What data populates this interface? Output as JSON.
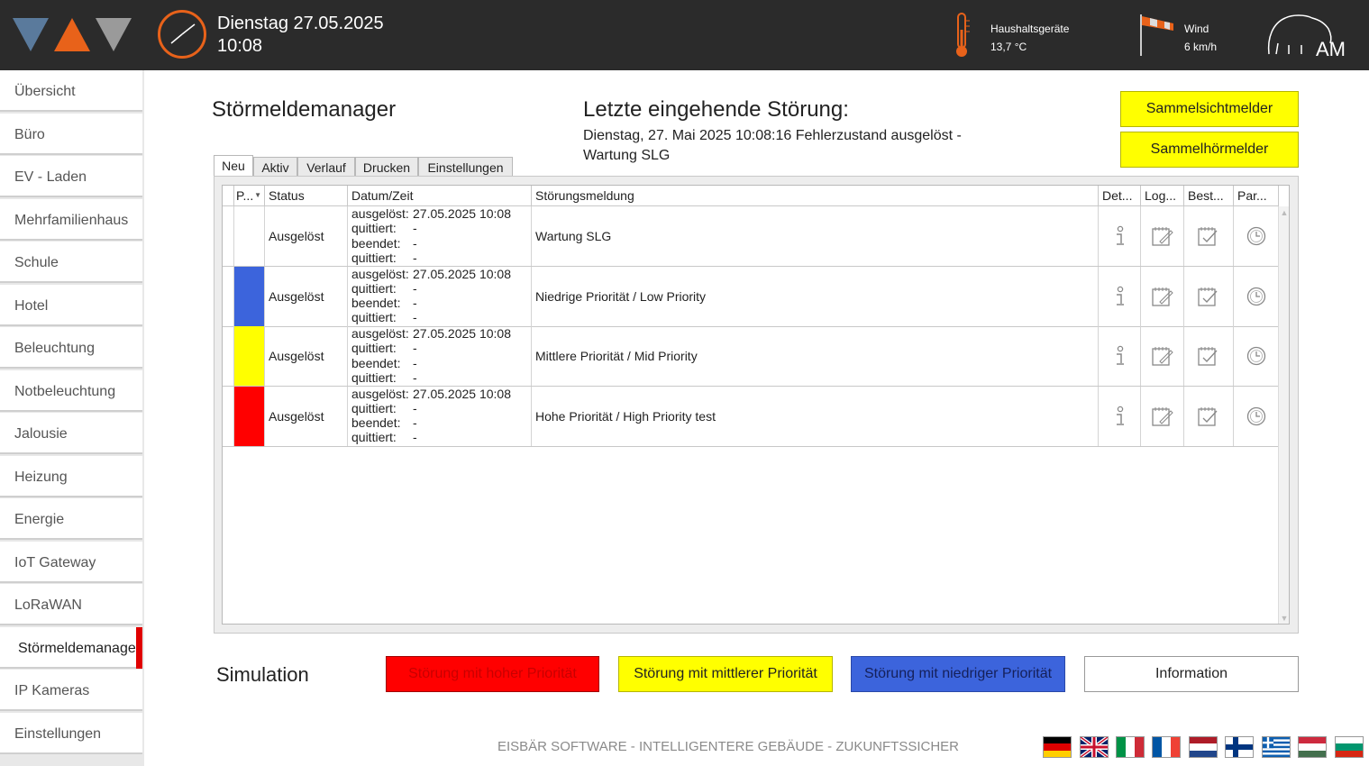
{
  "header": {
    "date": "Dienstag 27.05.2025",
    "time": "10:08",
    "temperature": {
      "label": "Haushaltsgeräte",
      "value": "13,7 °C"
    },
    "wind": {
      "label": "Wind",
      "value": "6 km/h"
    },
    "brand_text": "AM"
  },
  "sidebar": {
    "items": [
      {
        "label": "Übersicht"
      },
      {
        "label": "Büro"
      },
      {
        "label": "EV - Laden"
      },
      {
        "label": "Mehrfamilienhaus"
      },
      {
        "label": "Schule"
      },
      {
        "label": "Hotel"
      },
      {
        "label": "Beleuchtung"
      },
      {
        "label": "Notbeleuchtung"
      },
      {
        "label": "Jalousie"
      },
      {
        "label": "Heizung"
      },
      {
        "label": "Energie"
      },
      {
        "label": "IoT Gateway"
      },
      {
        "label": "LoRaWAN"
      },
      {
        "label": "Störmeldemanager",
        "active": true
      },
      {
        "label": "IP Kameras"
      },
      {
        "label": "Einstellungen"
      }
    ]
  },
  "main": {
    "title": "Störmeldemanager",
    "last_fault_title": "Letzte eingehende Störung:",
    "last_fault_text": "Dienstag, 27. Mai 2025 10:08:16 Fehlerzustand ausgelöst - Wartung SLG",
    "buttons": {
      "visual": "Sammelsichtmelder",
      "audio": "Sammelhörmelder"
    },
    "tabs": [
      "Neu",
      "Aktiv",
      "Verlauf",
      "Drucken",
      "Einstellungen"
    ],
    "table": {
      "columns": [
        "P...",
        "Status",
        "Datum/Zeit",
        "Störungsmeldung",
        "Det...",
        "Log...",
        "Best...",
        "Par..."
      ],
      "date_labels": [
        "ausgelöst:",
        "quittiert:",
        "beendet:",
        "quittiert:"
      ],
      "rows": [
        {
          "priority_color": "#ffffff",
          "status": "Ausgelöst",
          "dates": [
            "27.05.2025 10:08",
            "-",
            "-",
            "-"
          ],
          "message": "Wartung SLG"
        },
        {
          "priority_color": "#3c64dc",
          "status": "Ausgelöst",
          "dates": [
            "27.05.2025 10:08",
            "-",
            "-",
            "-"
          ],
          "message": "Niedrige Priorität / Low Priority"
        },
        {
          "priority_color": "#ffff00",
          "status": "Ausgelöst",
          "dates": [
            "27.05.2025 10:08",
            "-",
            "-",
            "-"
          ],
          "message": "Mittlere  Priorität / Mid Priority"
        },
        {
          "priority_color": "#ff0000",
          "status": "Ausgelöst",
          "dates": [
            "27.05.2025 10:08",
            "-",
            "-",
            "-"
          ],
          "message": "Hohe Priorität / High Priority test"
        }
      ]
    }
  },
  "simulation": {
    "label": "Simulation",
    "buttons": [
      {
        "label": "Störung mit hoher Priorität",
        "bg": "#ff0000",
        "fg": "#c80000"
      },
      {
        "label": "Störung mit mittlerer Priorität",
        "bg": "#ffff00",
        "fg": "#222222"
      },
      {
        "label": "Störung mit niedriger Priorität",
        "bg": "#3c64dc",
        "fg": "#15205a"
      },
      {
        "label": "Information",
        "bg": "#ffffff",
        "fg": "#222222"
      }
    ]
  },
  "footer": {
    "text": "EISBÄR SOFTWARE - INTELLIGENTERE GEBÄUDE - ZUKUNFTSSICHER",
    "flags": [
      "de",
      "uk",
      "it",
      "fr",
      "nl",
      "fi",
      "gr",
      "hu",
      "bg"
    ]
  },
  "colors": {
    "header_bg": "#2b2b2b",
    "accent_orange": "#e8621a",
    "active_marker": "#e00000"
  }
}
